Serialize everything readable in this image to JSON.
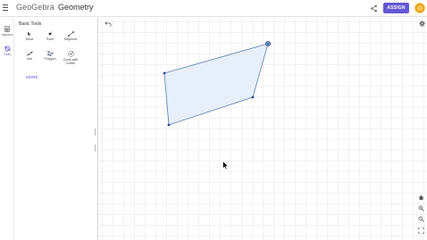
{
  "header": {
    "brand": "GeoGebra",
    "app_title": "Geometry",
    "assign_label": "ASSIGN",
    "share_icon": "share-icon",
    "avatar_icon": "avatar"
  },
  "rail": {
    "items": [
      {
        "label": "Algebra",
        "icon": "calculator-icon",
        "active": false
      },
      {
        "label": "Tools",
        "icon": "tools-icon",
        "active": true
      }
    ]
  },
  "tools_panel": {
    "title": "Basic Tools",
    "tools": [
      {
        "label": "Move",
        "icon": "move-icon"
      },
      {
        "label": "Point",
        "icon": "point-icon"
      },
      {
        "label": "Segment",
        "icon": "segment-icon"
      },
      {
        "label": "Line",
        "icon": "line-icon"
      },
      {
        "label": "Polygon",
        "icon": "polygon-icon"
      },
      {
        "label": "Circle with Center",
        "icon": "circle-with-center-icon"
      }
    ],
    "more_label": "MORE"
  },
  "graphics": {
    "polygon_fill": "#e6eefa",
    "polygon_stroke": "#5b7fb0",
    "point_color": "#2c4f8c",
    "accent": "#6557d2"
  }
}
